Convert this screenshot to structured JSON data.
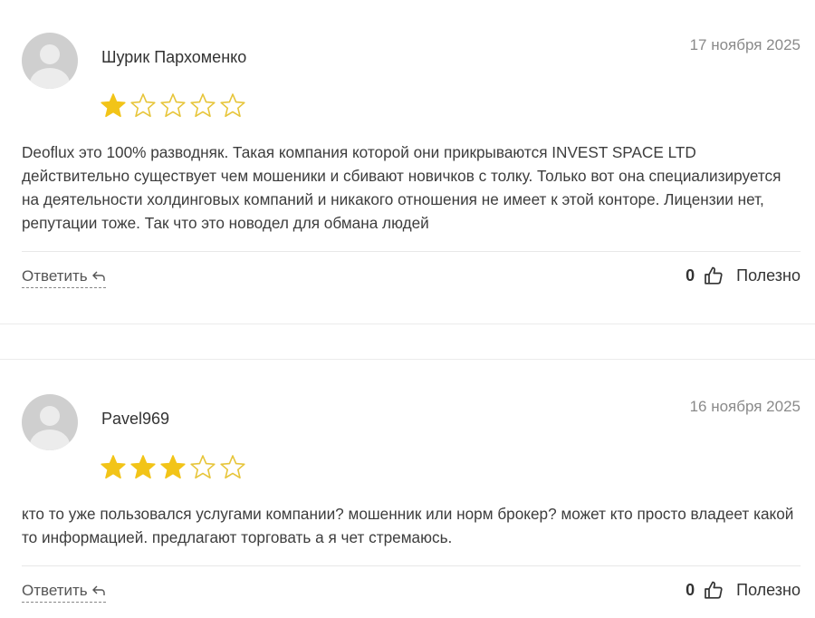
{
  "reviews": [
    {
      "author": "Шурик Пархоменко",
      "date": "17 ноября 2025",
      "rating": 1,
      "max_rating": 5,
      "text": "Deoflux это 100% разводняк. Такая компания которой они прикрываются INVEST SPACE LTD действительно существует чем мошеники и сбивают новичков с толку. Только вот она специализируется на деятельности холдинговых компаний и никакого отношения не имеет к этой конторе. Лицензии нет, репутации тоже. Так что это новодел для обмана людей",
      "reply_label": "Ответить",
      "likes": "0",
      "useful_label": "Полезно"
    },
    {
      "author": "Pavel969",
      "date": "16 ноября 2025",
      "rating": 3,
      "max_rating": 5,
      "text": "кто то уже пользовался услугами компании? мошенник или норм брокер? может кто просто владеет какой то информацией. предлагают торговать а я чет стремаюсь.",
      "reply_label": "Ответить",
      "likes": "0",
      "useful_label": "Полезно"
    }
  ],
  "colors": {
    "star_filled": "#f2c418",
    "star_outline": "#e7c53a",
    "avatar_bg": "#cfcfcf",
    "avatar_fg": "#e9e9e9"
  }
}
